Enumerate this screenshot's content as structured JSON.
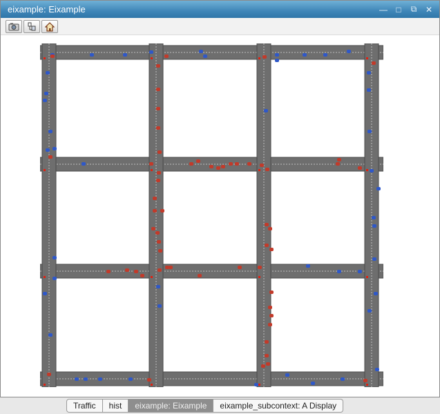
{
  "window": {
    "title": "eixample: Eixample"
  },
  "toolbar": {
    "buttons": [
      {
        "name": "snapshot",
        "icon": "camera-icon"
      },
      {
        "name": "inspect",
        "icon": "inspect-agents-icon"
      },
      {
        "name": "home",
        "icon": "home-icon"
      }
    ]
  },
  "tabs": [
    {
      "label": "Traffic",
      "active": false
    },
    {
      "label": "hist",
      "active": false
    },
    {
      "label": "eixample: Eixample",
      "active": true
    },
    {
      "label": "eixample_subcontext: A Display",
      "active": false
    }
  ],
  "colors": {
    "road": "#6e6e6e",
    "road_edge": "#4a4a4a",
    "lane_marking": "#bdbdbd",
    "car_blue": "#2f58c8",
    "car_red": "#c23a2a",
    "intersection_marker": "#e02010",
    "title_bar": "#3f86b8"
  }
}
